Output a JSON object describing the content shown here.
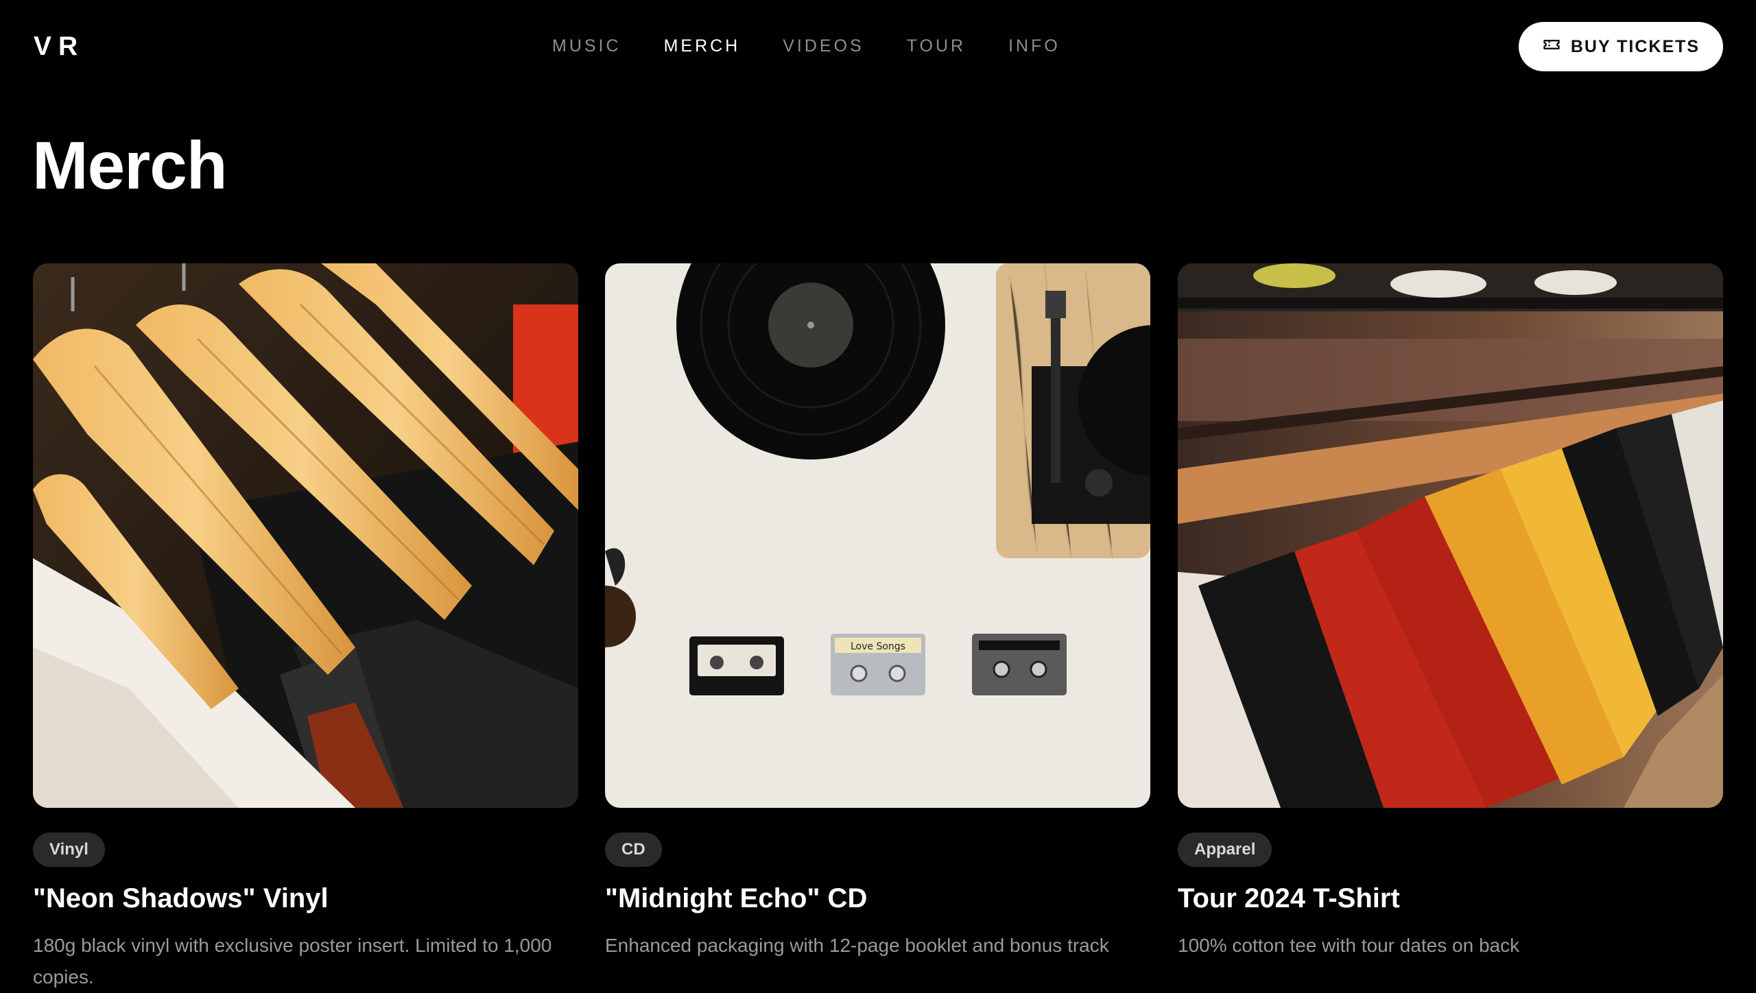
{
  "header": {
    "logo": "VR",
    "nav": [
      {
        "label": "MUSIC",
        "active": false
      },
      {
        "label": "MERCH",
        "active": true
      },
      {
        "label": "VIDEOS",
        "active": false
      },
      {
        "label": "TOUR",
        "active": false
      },
      {
        "label": "INFO",
        "active": false
      }
    ],
    "cta": {
      "label": "BUY TICKETS",
      "icon": "ticket-icon"
    }
  },
  "page": {
    "title": "Merch"
  },
  "products": [
    {
      "tag": "Vinyl",
      "title": "\"Neon Shadows\" Vinyl",
      "description": "180g black vinyl with exclusive poster insert. Limited to 1,000 copies.",
      "image": "wooden hangers with shirts"
    },
    {
      "tag": "CD",
      "title": "\"Midnight Echo\" CD",
      "description": "Enhanced packaging with 12-page booklet and bonus track",
      "image": "vinyl record, turntable and cassette tapes",
      "image_text": [
        "Love Songs"
      ]
    },
    {
      "tag": "Apparel",
      "title": "Tour 2024 T-Shirt",
      "description": "100% cotton tee with tour dates on back",
      "image": "rack of colorful t-shirts"
    }
  ],
  "colors": {
    "background": "#000000",
    "text": "#ffffff",
    "nav_inactive": "#8e8e8e",
    "tag_bg": "#2a2a2a",
    "muted": "#9a9a9a"
  }
}
